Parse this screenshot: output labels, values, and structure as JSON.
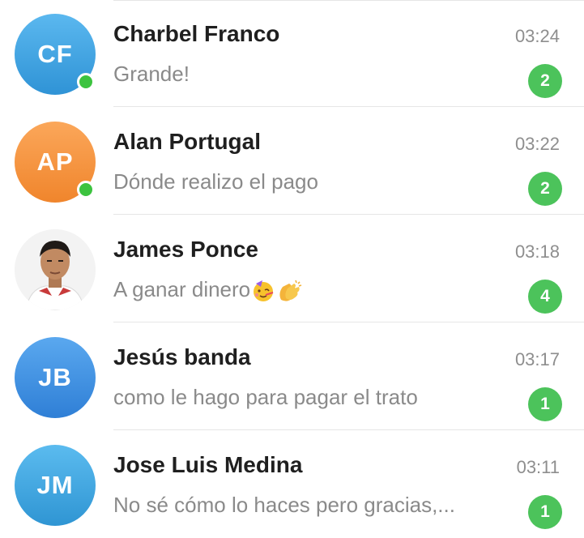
{
  "colors": {
    "online": "#3cc33f",
    "badge": "#4cc35b",
    "avatar_cf": "#3fa2e0",
    "avatar_ap": "#f5913a",
    "avatar_jb": "#3d8fe0",
    "avatar_jm": "#3fa8dc"
  },
  "chats": [
    {
      "initials": "CF",
      "name": "Charbel Franco",
      "time": "03:24",
      "preview": "Grande!",
      "unread": "2",
      "online": true
    },
    {
      "initials": "AP",
      "name": "Alan Portugal",
      "time": "03:22",
      "preview": "Dónde realizo el pago",
      "unread": "2",
      "online": true
    },
    {
      "initials": "",
      "name": "James Ponce",
      "time": "03:18",
      "preview": "A ganar dinero",
      "unread": "4",
      "online": false,
      "emojis": [
        "partying-face-emoji",
        "clapping-hands-emoji"
      ]
    },
    {
      "initials": "JB",
      "name": "Jesús banda",
      "time": "03:17",
      "preview": "como le hago para pagar el trato",
      "unread": "1",
      "online": false
    },
    {
      "initials": "JM",
      "name": "Jose Luis Medina",
      "time": "03:11",
      "preview": "No sé cómo lo haces pero gracias,...",
      "unread": "1",
      "online": false
    }
  ]
}
